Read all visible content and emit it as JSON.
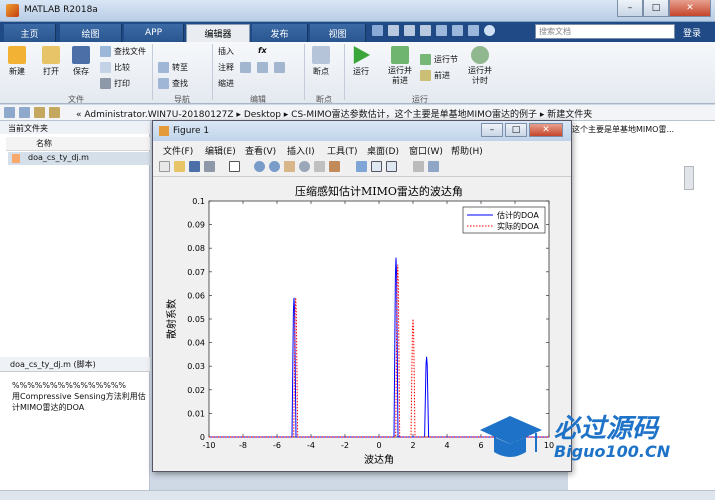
{
  "app": {
    "title": "MATLAB R2018a"
  },
  "tabs": [
    "主页",
    "绘图",
    "APP",
    "编辑器",
    "发布",
    "视图"
  ],
  "active_tab": "编辑器",
  "search": {
    "placeholder": "搜索文档"
  },
  "login": "登录",
  "ribbon": {
    "new": "新建",
    "open": "打开",
    "save": "保存",
    "find_files": "查找文件",
    "compare": "比较",
    "print": "打印",
    "insert": "插入",
    "fx": "fx",
    "comment": "注释",
    "indent": "缩进",
    "goto": "转至",
    "find": "查找",
    "breakpoint": "断点",
    "run": "运行",
    "run_advance": "运行并前进",
    "run_section": "运行节",
    "advance": "前进",
    "run_time": "运行并计时",
    "groups": {
      "file": "文件",
      "nav": "导航",
      "edit": "编辑",
      "bp": "断点",
      "run": "运行"
    }
  },
  "address": {
    "path": "« Administrator.WIN7U-20180127Z  ▸  Desktop  ▸  CS-MIMO雷达参数估计，这个主要是单基地MIMO雷达的例子  ▸  新建文件夹"
  },
  "left_panel": {
    "title": "当前文件夹",
    "col_name": "名称",
    "file": "doa_cs_ty_dj.m"
  },
  "details": {
    "title": "doa_cs_ty_dj.m  (脚本)",
    "lines": [
      "%%%%%%%%%%%%%%%",
      "用Compressive Sensing方法利用估",
      "计MIMO雷达的DOA"
    ]
  },
  "right_panel": {
    "text": "这个主要是单基地MIMO雷..."
  },
  "figure": {
    "title": "Figure 1",
    "menu": [
      "文件(F)",
      "编辑(E)",
      "查看(V)",
      "插入(I)",
      "工具(T)",
      "桌面(D)",
      "窗口(W)",
      "帮助(H)"
    ]
  },
  "watermark": {
    "cn": "必过源码",
    "en": "Biguo100.CN",
    "colors": {
      "main": "#1e73c8",
      "accent": "#e0382b"
    }
  },
  "chart_data": {
    "type": "line",
    "title": "压缩感知估计MIMO雷达的波达角",
    "xlabel": "波达角",
    "ylabel": "散射系数",
    "xlim": [
      -10,
      10
    ],
    "ylim": [
      0,
      0.1
    ],
    "xticks": [
      -10,
      -8,
      -6,
      -4,
      -2,
      0,
      2,
      4,
      6,
      8,
      10
    ],
    "yticks": [
      0,
      0.01,
      0.02,
      0.03,
      0.04,
      0.05,
      0.06,
      0.07,
      0.08,
      0.09,
      0.1
    ],
    "ytick_labels": [
      "0",
      "0.01",
      "0.02",
      "0.03",
      "0.04",
      "0.05",
      "0.06",
      "0.07",
      "0.08",
      "0.09",
      "0.1"
    ],
    "legend": {
      "placement": "top-right"
    },
    "series": [
      {
        "name": "估计的DOA",
        "color": "#0000ff",
        "style": "solid",
        "peaks": [
          {
            "x": -5.0,
            "y": 0.059
          },
          {
            "x": 1.0,
            "y": 0.076
          },
          {
            "x": 2.8,
            "y": 0.034
          }
        ]
      },
      {
        "name": "实际的DOA",
        "color": "#ff0000",
        "style": "dotted",
        "peaks": [
          {
            "x": -4.9,
            "y": 0.059
          },
          {
            "x": 1.1,
            "y": 0.073
          },
          {
            "x": 2.0,
            "y": 0.05
          }
        ]
      }
    ]
  }
}
